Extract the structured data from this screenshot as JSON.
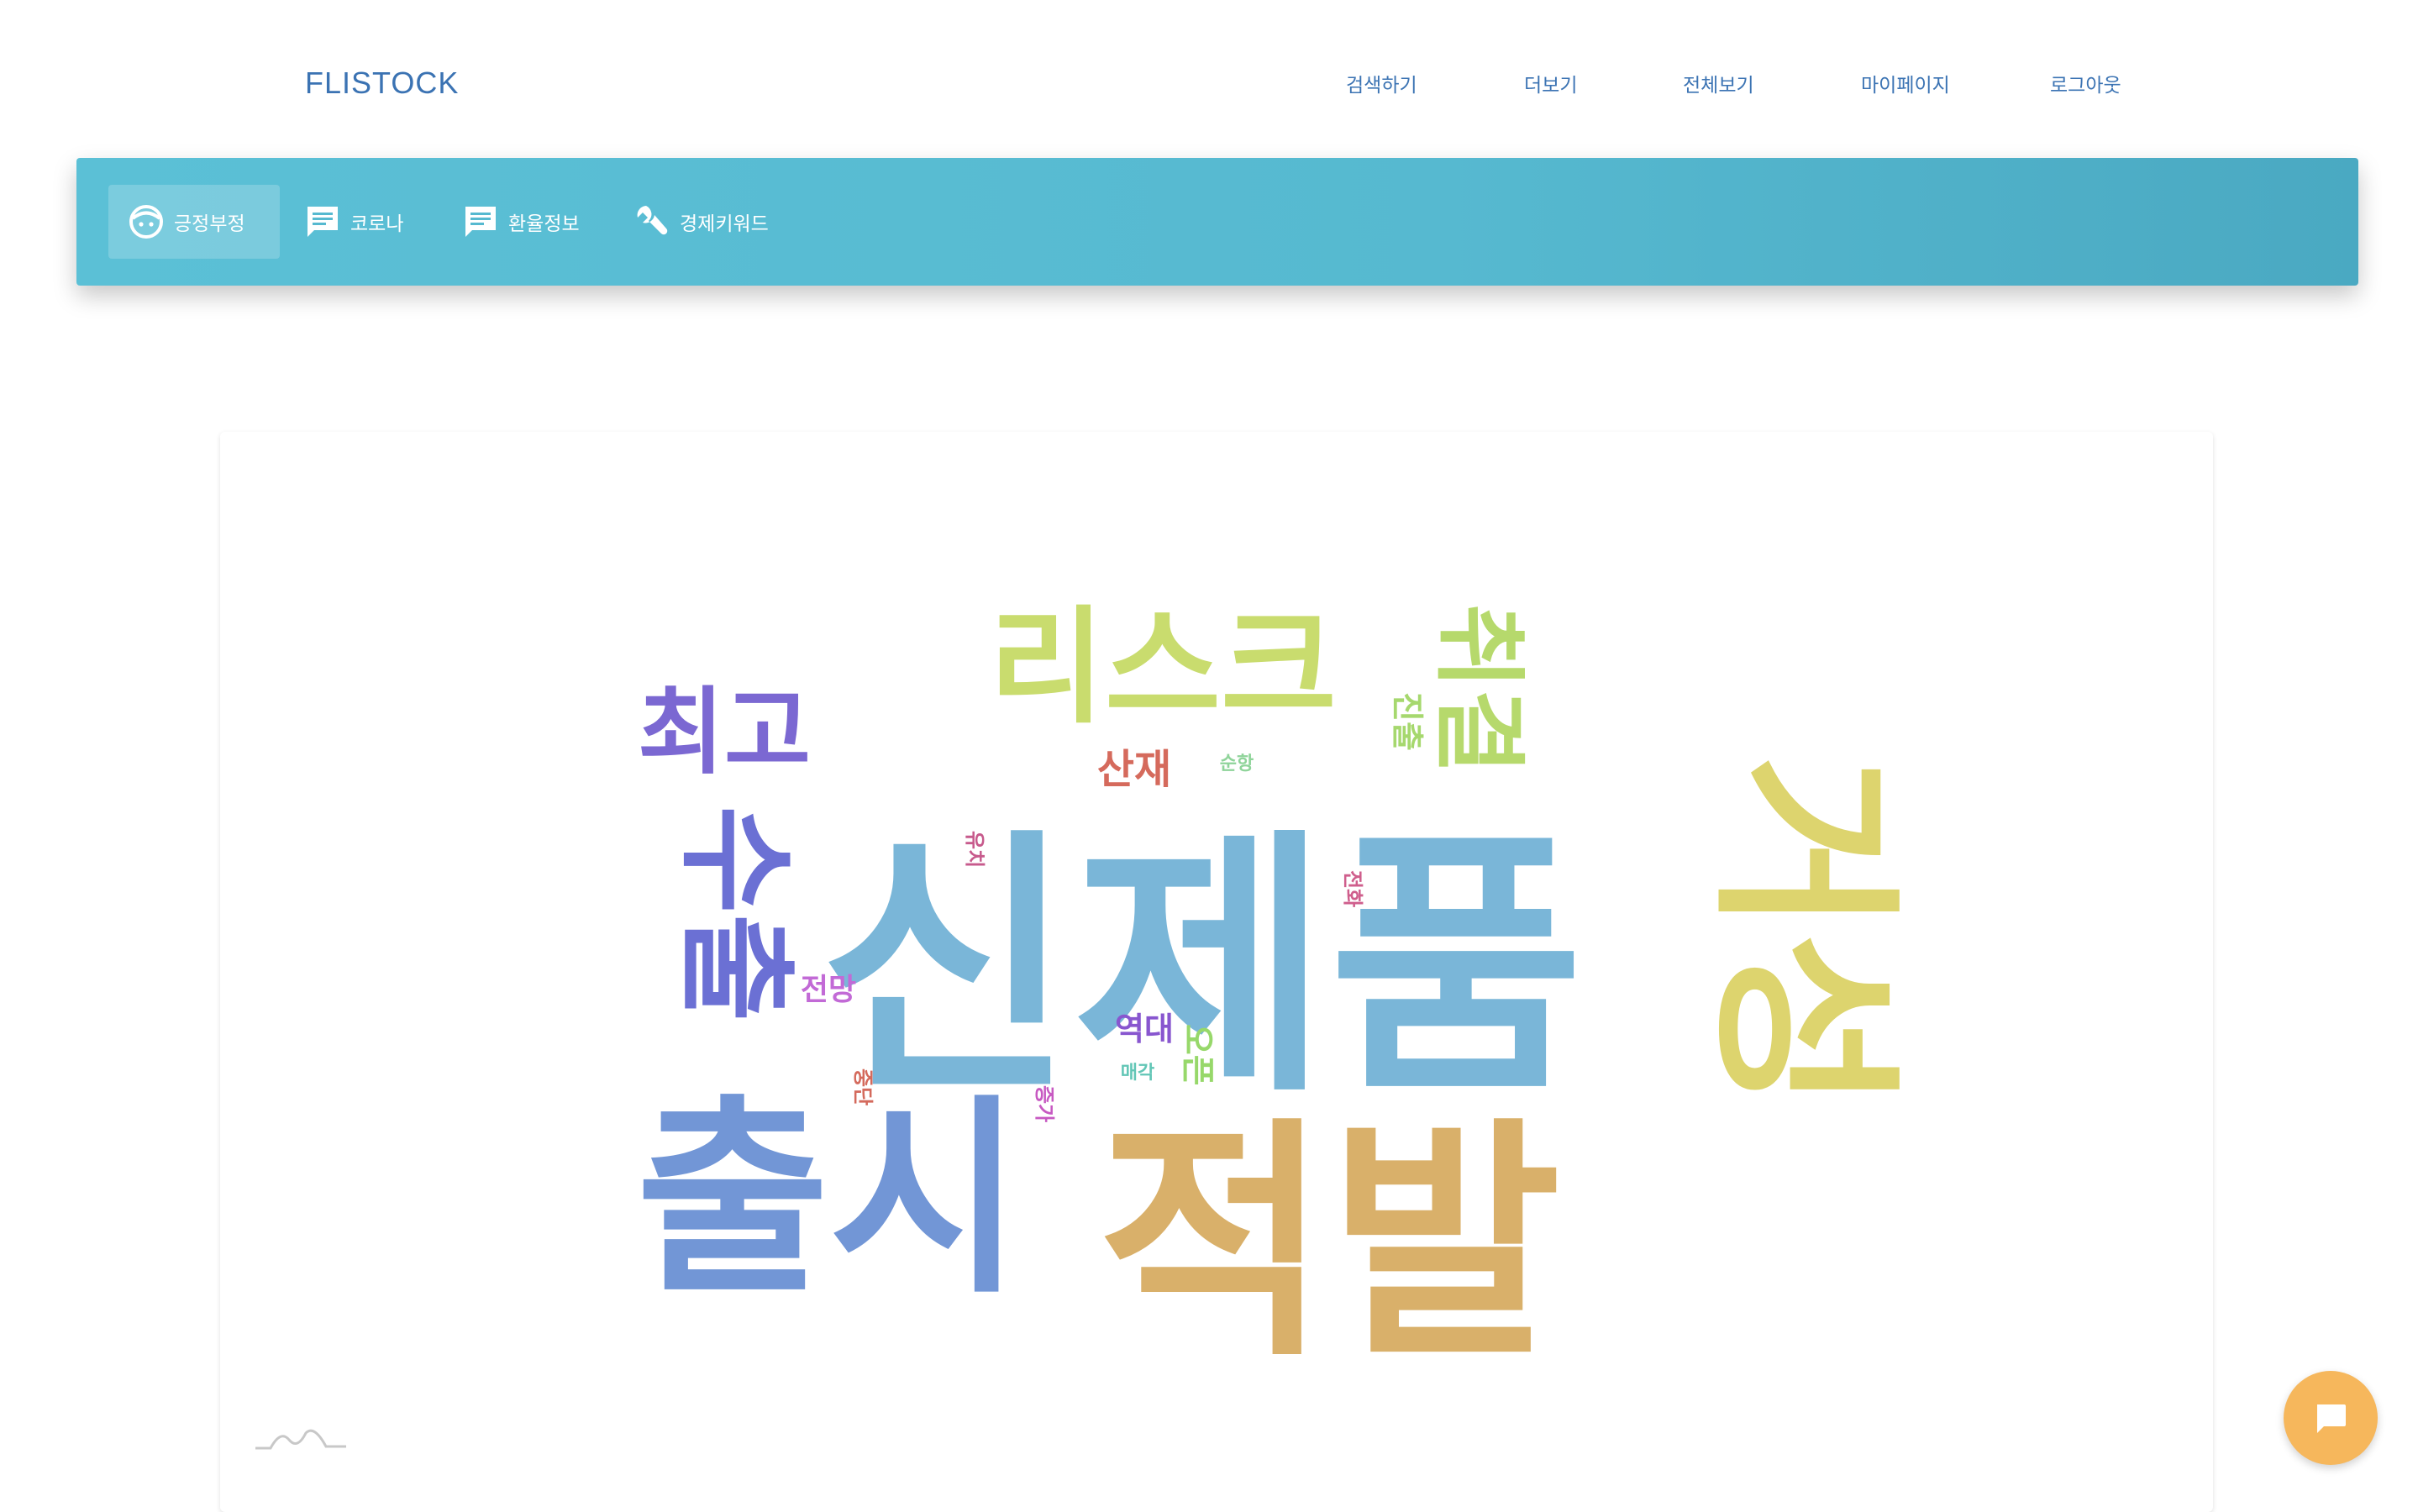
{
  "brand": "FLISTOCK",
  "topnav": [
    "검색하기",
    "더보기",
    "전체보기",
    "마이페이지",
    "로그아웃"
  ],
  "tabs": [
    {
      "label": "긍정부정",
      "icon": "face-icon",
      "active": true
    },
    {
      "label": "코로나",
      "icon": "chat-icon",
      "active": false
    },
    {
      "label": "환율정보",
      "icon": "chat-icon",
      "active": false
    },
    {
      "label": "경제키워드",
      "icon": "wrench-icon",
      "active": false
    }
  ],
  "wordcloud": [
    {
      "text": "신제품",
      "color": "#7ab6d8"
    },
    {
      "text": "적발",
      "color": "#d9b06a"
    },
    {
      "text": "출시",
      "color": "#7296d6"
    },
    {
      "text": "거성",
      "color": "#ddd46e"
    },
    {
      "text": "리스크",
      "color": "#c9dc6e"
    },
    {
      "text": "최고",
      "color": "#7b68d2"
    },
    {
      "text": "수출",
      "color": "#6b70d4"
    },
    {
      "text": "취결",
      "color": "#b6d96c"
    },
    {
      "text": "산재",
      "color": "#d56a5c"
    },
    {
      "text": "진출",
      "color": "#a6d86e"
    },
    {
      "text": "순항",
      "color": "#8fd49a"
    },
    {
      "text": "유치",
      "color": "#c75a8c"
    },
    {
      "text": "전화",
      "color": "#cf5e8c"
    },
    {
      "text": "전망",
      "color": "#c26ad6"
    },
    {
      "text": "역대",
      "color": "#8856cf"
    },
    {
      "text": "오픈",
      "color": "#97d86a"
    },
    {
      "text": "매각",
      "color": "#62c6b6"
    },
    {
      "text": "중단",
      "color": "#d46a5c"
    },
    {
      "text": "증가",
      "color": "#c759c2"
    }
  ],
  "colors": {
    "accent": "#5bc0d6",
    "brand": "#3b73b3",
    "chat": "#f6b75c"
  }
}
